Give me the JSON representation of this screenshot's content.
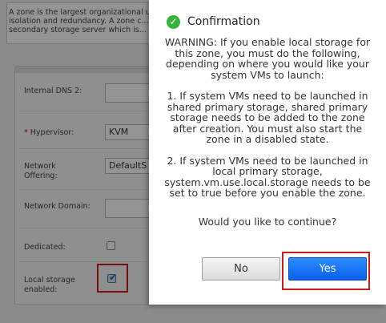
{
  "zone_info": {
    "line1": "A zone is the largest organizational unit...",
    "line2": "isolation and redundancy. A zone c...",
    "line3": "secondary storage server which is..."
  },
  "form": {
    "internal_dns2_label": "Internal DNS 2:",
    "internal_dns2_value": "",
    "hypervisor_required": "*",
    "hypervisor_label": "Hypervisor:",
    "hypervisor_value": "KVM",
    "network_offering_label_1": "Network",
    "network_offering_label_2": "Offering:",
    "network_offering_value": "DefaultS",
    "network_domain_label": "Network Domain:",
    "network_domain_value": "",
    "dedicated_label": "Dedicated:",
    "dedicated_checked": false,
    "local_storage_label_1": "Local storage",
    "local_storage_label_2": "enabled:",
    "local_storage_checked": true
  },
  "dialog": {
    "title": "Confirmation",
    "icon": "check-circle-icon",
    "paragraph1": "WARNING: If you enable local storage for this zone, you must do the following, depending on where you would like your system VMs to launch:",
    "paragraph2": "1. If system VMs need to be launched in shared primary storage, shared primary storage needs to be added to the zone after creation. You must also start the zone in a disabled state.",
    "paragraph3": "2. If system VMs need to be launched in local primary storage, system.vm.use.local.storage needs to be set to true before you enable the zone.",
    "question": "Would you like to continue?",
    "no_label": "No",
    "yes_label": "Yes"
  },
  "colors": {
    "accent": "#0a60e8",
    "highlight": "#d01818",
    "success": "#37b33a"
  }
}
